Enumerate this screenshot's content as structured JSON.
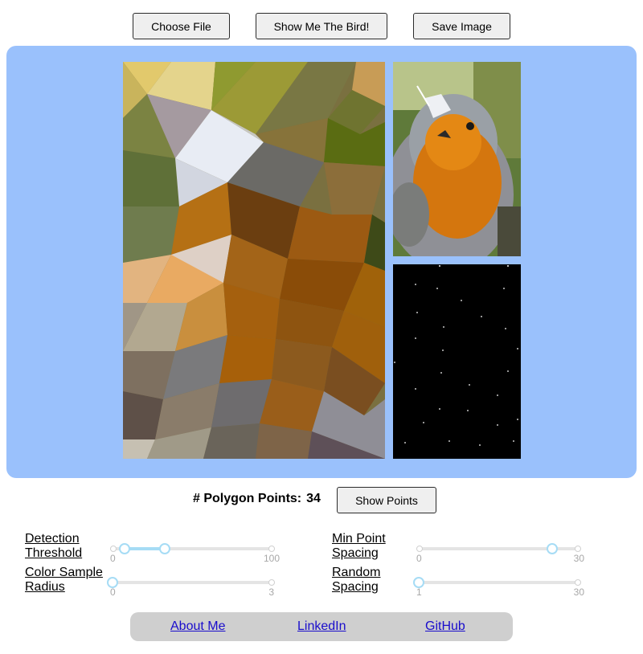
{
  "toolbar": {
    "choose_file_label": "Choose File",
    "show_bird_label": "Show Me The Bird!",
    "save_image_label": "Save Image"
  },
  "stats": {
    "polygon_points_label": "# Polygon Points:",
    "polygon_points_value": "34",
    "show_points_label": "Show Points"
  },
  "controls": {
    "detection_threshold": {
      "label_line1": "Detection",
      "label_line2": "Threshold",
      "min": "0",
      "max": "100",
      "low": 5,
      "high": 30
    },
    "min_point_spacing": {
      "label_line1": "Min Point",
      "label_line2": "Spacing",
      "min": "0",
      "max": "30",
      "value": 25
    },
    "color_sample_radius": {
      "label_line1": "Color Sample",
      "label_line2": "Radius",
      "min": "0",
      "max": "3",
      "value": 0
    },
    "random_spacing": {
      "label_line1": "Random",
      "label_line2": "Spacing",
      "min": "1",
      "max": "30",
      "value": 1
    }
  },
  "footer": {
    "about_label": "About Me",
    "linkedin_label": "LinkedIn",
    "github_label": "GitHub"
  },
  "colors": {
    "panel_bg": "#9ac1fc",
    "slider_accent": "#a6dcf5",
    "link": "#1a0dcc"
  }
}
